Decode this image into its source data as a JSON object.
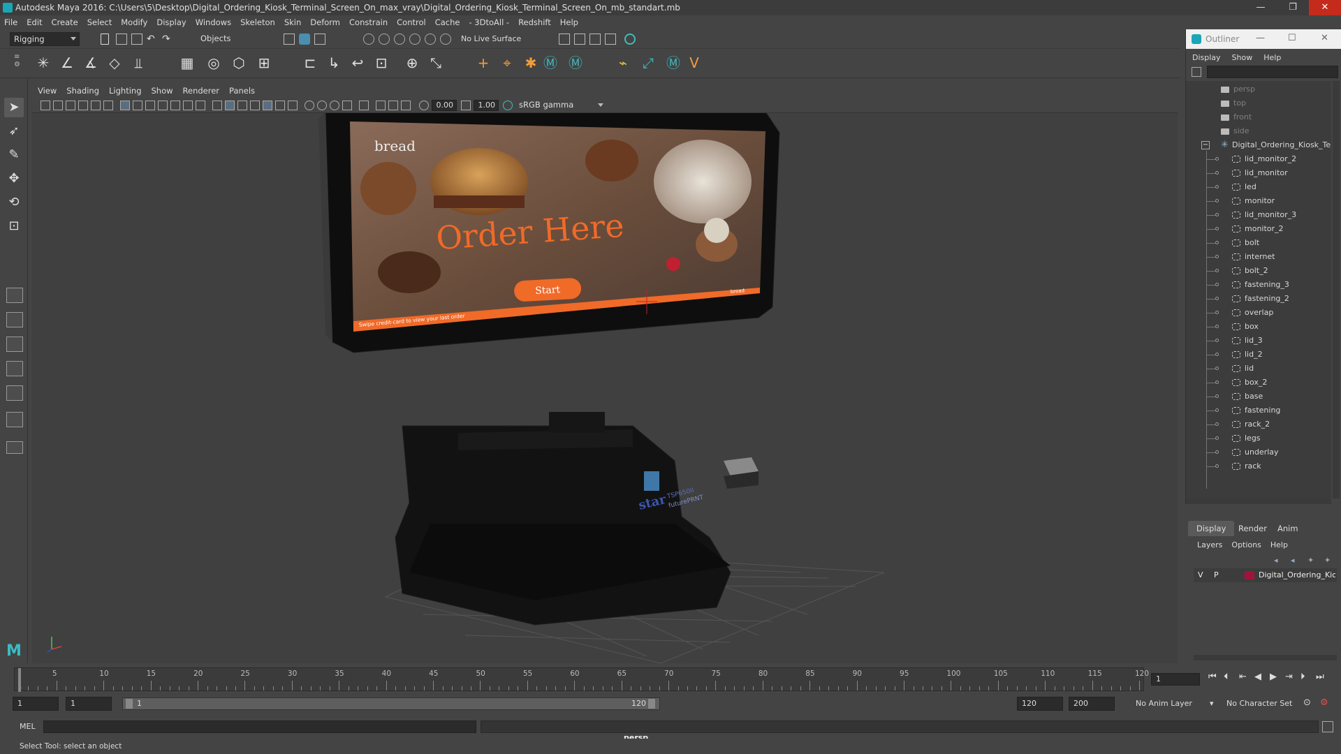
{
  "window": {
    "title": "Autodesk Maya 2016: C:\\Users\\5\\Desktop\\Digital_Ordering_Kiosk_Terminal_Screen_On_max_vray\\Digital_Ordering_Kiosk_Terminal_Screen_On_mb_standart.mb",
    "minimize": "—",
    "maximize": "❐",
    "close": "✕"
  },
  "menubar": [
    "File",
    "Edit",
    "Create",
    "Select",
    "Modify",
    "Display",
    "Windows",
    "Skeleton",
    "Skin",
    "Deform",
    "Constrain",
    "Control",
    "Cache",
    "- 3DtoAll -",
    "Redshift",
    "Help"
  ],
  "toolbar": {
    "mode": "Rigging",
    "selection_mode": "Objects",
    "live_surface": "No Live Surface"
  },
  "viewport": {
    "menu": [
      "View",
      "Shading",
      "Lighting",
      "Show",
      "Renderer",
      "Panels"
    ],
    "exposure": "0.00",
    "gamma": "1.00",
    "color_space": "sRGB gamma",
    "camera_label": "persp"
  },
  "kiosk_screen": {
    "brand": "bread",
    "headline": "Order Here",
    "start_button": "Start",
    "footer_text": "Swipe credit-card to view your last order",
    "footer_brand": "bread",
    "printer_brand": "star",
    "printer_model": "futurePRNT",
    "printer_sub": "TSP650II"
  },
  "outliner": {
    "title": "Outliner",
    "menu": [
      "Display",
      "Show",
      "Help"
    ],
    "cameras": [
      "persp",
      "top",
      "front",
      "side"
    ],
    "root": "Digital_Ordering_Kiosk_Terminal",
    "children": [
      "lid_monitor_2",
      "lid_monitor",
      "led",
      "monitor",
      "lid_monitor_3",
      "monitor_2",
      "bolt",
      "internet",
      "bolt_2",
      "fastening_3",
      "fastening_2",
      "overlap",
      "box",
      "lid_3",
      "lid_2",
      "lid",
      "box_2",
      "base",
      "fastening",
      "rack_2",
      "legs",
      "underlay",
      "rack"
    ]
  },
  "layers": {
    "tabs": [
      "Display",
      "Render",
      "Anim"
    ],
    "menu": [
      "Layers",
      "Options",
      "Help"
    ],
    "layer": {
      "v": "V",
      "p": "P",
      "name": "Digital_Ordering_Kiosk",
      "color": "#a0143c"
    }
  },
  "timeline": {
    "ticks": [
      "5",
      "10",
      "15",
      "20",
      "25",
      "30",
      "35",
      "40",
      "45",
      "50",
      "55",
      "60",
      "65",
      "70",
      "75",
      "80",
      "85",
      "90",
      "95",
      "100",
      "105",
      "110",
      "115",
      "120"
    ],
    "start_tick": "1",
    "current_frame": "1"
  },
  "range": {
    "start": "1",
    "playback_start": "1",
    "slider_start": "1",
    "slider_end": "120",
    "playback_end": "120",
    "end": "200",
    "anim_layer": "No Anim Layer",
    "character_set": "No Character Set"
  },
  "command": {
    "label": "MEL"
  },
  "status": "Select Tool: select an object",
  "colors": {
    "accent": "#1aa6b7",
    "kiosk_orange": "#f06a28",
    "close_red": "#c42b1c"
  }
}
